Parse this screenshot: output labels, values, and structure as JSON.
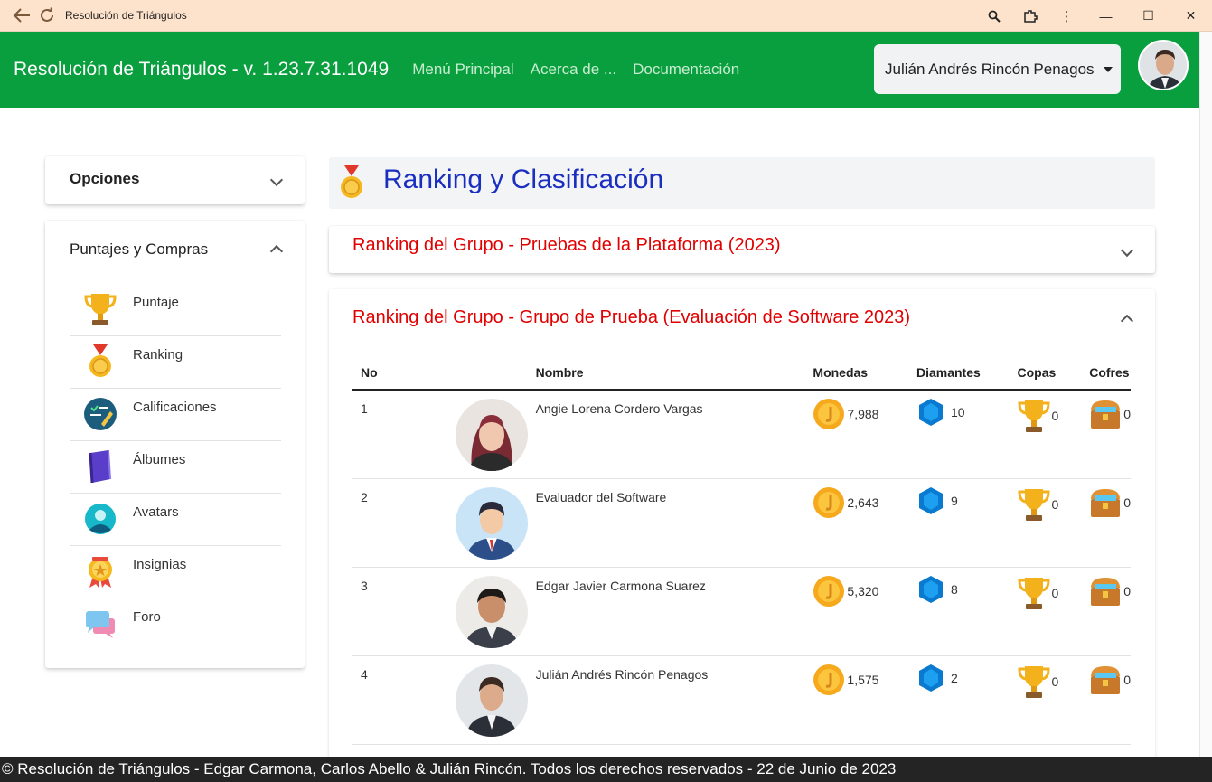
{
  "window": {
    "title": "Resolución de Triángulos"
  },
  "app": {
    "brand": "Resolución de Triángulos - v. 1.23.7.31.1049",
    "nav": [
      "Menú Principal",
      "Acerca de ...",
      "Documentación"
    ],
    "user_name": "Julián Andrés Rincón Penagos",
    "brand_color": "#0a9f3e"
  },
  "sidebar": {
    "opciones_title": "Opciones",
    "puntajes_title": "Puntajes y Compras",
    "items": [
      {
        "label": "Puntaje",
        "icon": "trophy-icon"
      },
      {
        "label": "Ranking",
        "icon": "medal-icon"
      },
      {
        "label": "Calificaciones",
        "icon": "grades-icon"
      },
      {
        "label": "Álbumes",
        "icon": "album-icon"
      },
      {
        "label": "Avatars",
        "icon": "avatar-icon"
      },
      {
        "label": "Insignias",
        "icon": "badge-icon"
      },
      {
        "label": "Foro",
        "icon": "forum-icon"
      }
    ]
  },
  "main": {
    "page_title": "Ranking y Clasificación",
    "accordion1_title": "Ranking del Grupo - Pruebas de la Plataforma (2023)",
    "accordion2_title": "Ranking del Grupo - Grupo de Prueba (Evaluación de Software 2023)",
    "columns": [
      "No",
      "",
      "Nombre",
      "Monedas",
      "Diamantes",
      "Copas",
      "Cofres"
    ],
    "rows": [
      {
        "no": "1",
        "name": "Angie Lorena Cordero Vargas",
        "coins": "7,988",
        "diamonds": "10",
        "cups": "0",
        "chests": "0"
      },
      {
        "no": "2",
        "name": "Evaluador del Software",
        "coins": "2,643",
        "diamonds": "9",
        "cups": "0",
        "chests": "0"
      },
      {
        "no": "3",
        "name": "Edgar Javier Carmona Suarez",
        "coins": "5,320",
        "diamonds": "8",
        "cups": "0",
        "chests": "0"
      },
      {
        "no": "4",
        "name": "Julián Andrés Rincón Penagos",
        "coins": "1,575",
        "diamonds": "2",
        "cups": "0",
        "chests": "0"
      }
    ]
  },
  "footer": {
    "text": "© Resolución de Triángulos - Edgar Carmona, Carlos Abello & Julián Rincón. Todos los derechos reservados - 22 de Junio de 2023"
  }
}
